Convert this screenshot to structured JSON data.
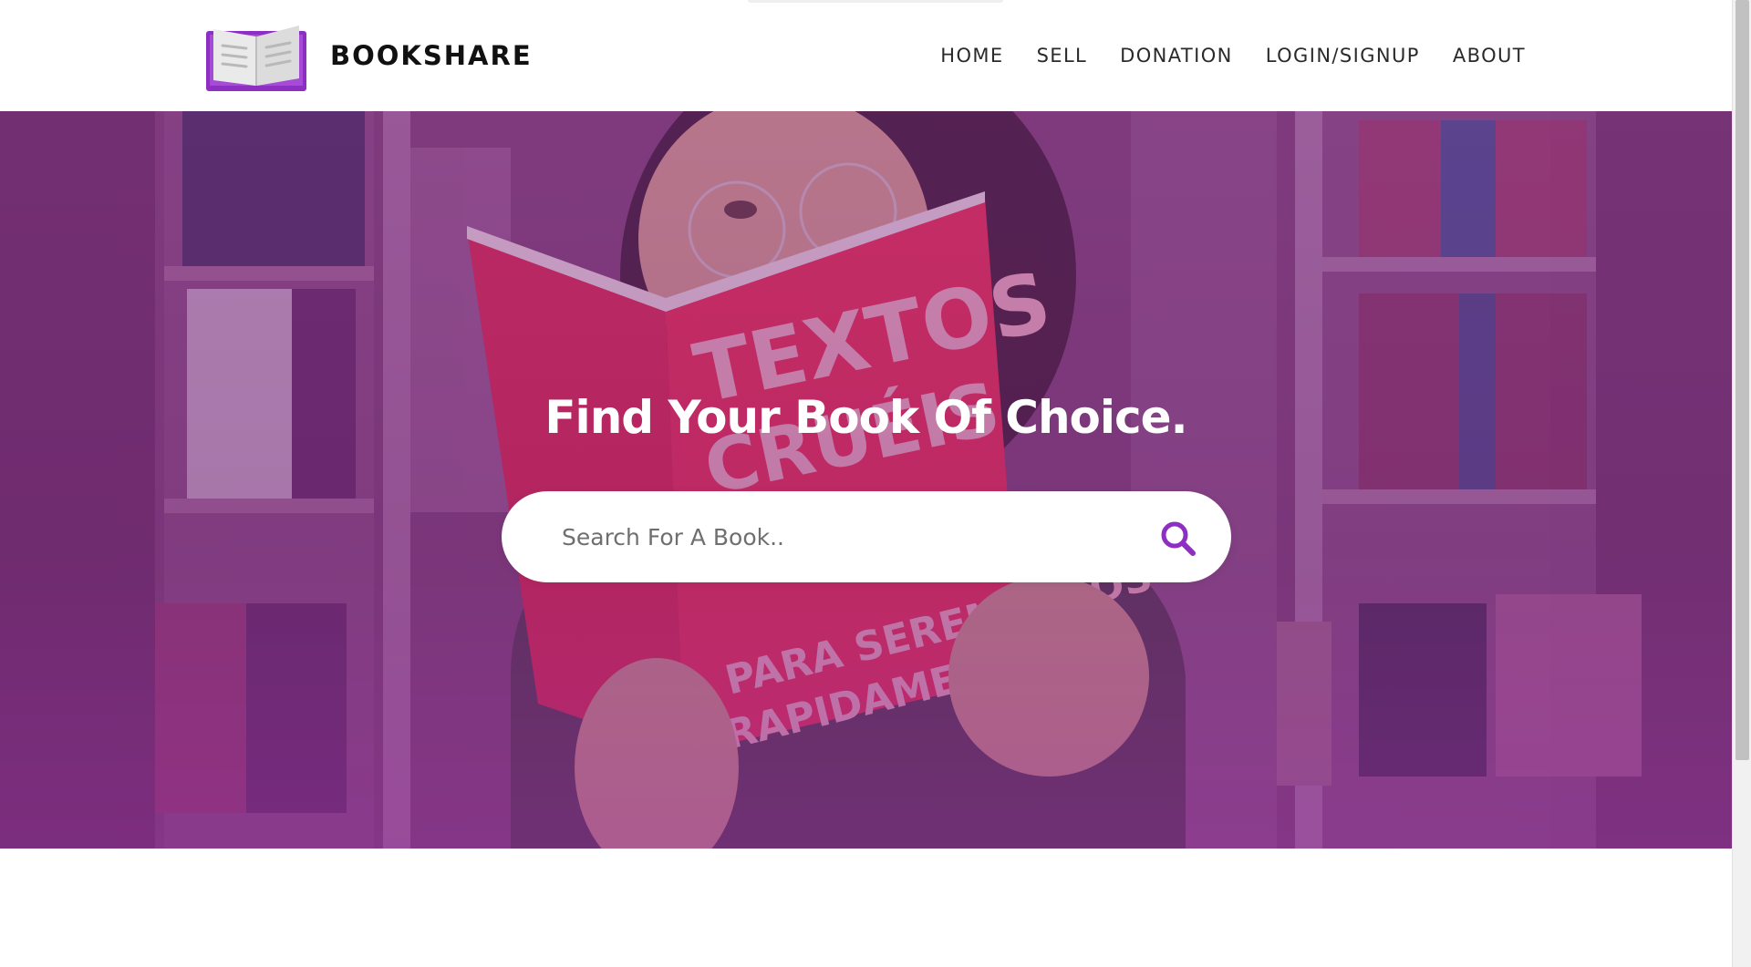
{
  "brand": {
    "name": "BOOKSHARE",
    "logo_icon": "open-book-icon",
    "colors": {
      "cover": "#8e2fc4",
      "pages": "#e6e6e6"
    }
  },
  "nav": {
    "items": [
      {
        "label": "HOME"
      },
      {
        "label": "SELL"
      },
      {
        "label": "DONATION"
      },
      {
        "label": "LOGIN/SIGNUP"
      },
      {
        "label": "ABOUT"
      }
    ]
  },
  "hero": {
    "title": "Find Your Book Of Choice.",
    "background": "woman-reading-book-in-library-photo",
    "overlay_color": "#7a2a88",
    "search": {
      "placeholder": "Search For A Book..",
      "value": "",
      "icon": "search-icon",
      "icon_color": "#8e2fc4"
    }
  }
}
